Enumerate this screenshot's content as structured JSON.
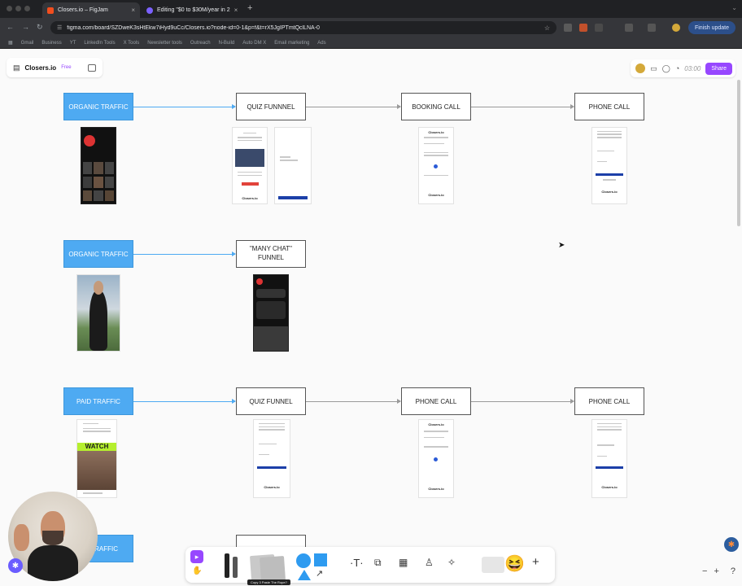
{
  "browser": {
    "tabs": [
      {
        "title": "Closers.io – FigJam",
        "active": true
      },
      {
        "title": "Editing \"$0 to $30M/year in 2",
        "active": false
      }
    ],
    "url": "figma.com/board/SZDweK3sHtEkw7iHyd9uCc/Closers.io?node-id=0-1&p=f&t=rX5JgIPTmtQclLNA-0",
    "finish_update": "Finish update",
    "bookmarks": [
      "Gmail",
      "Business",
      "YT",
      "LinkedIn Tools",
      "X Tools",
      "Newsletter tools",
      "Outreach",
      "N-Build",
      "Auto DM X",
      "Email marketing",
      "Ads"
    ]
  },
  "figjam": {
    "file_name": "Closers.io",
    "plan_badge": "Free",
    "timer": "03:00",
    "share_label": "Share"
  },
  "flows": [
    {
      "source": "ORGANIC TRAFFIC",
      "steps": [
        "QUIZ FUNNNEL",
        "BOOKING CALL",
        "PHONE CALL"
      ]
    },
    {
      "source": "ORGANIC TRAFFIC",
      "steps": [
        "\"MANY CHAT\" FUNNEL"
      ]
    },
    {
      "source": "PAID TRAFFIC",
      "steps": [
        "QUIZ FUNNEL",
        "PHONE CALL",
        "PHONE CALL"
      ]
    },
    {
      "source": "TRAFFIC",
      "steps": [
        ""
      ]
    }
  ],
  "thumbnail_text": {
    "brand": "Closers.io",
    "watch": "WATCH THIS"
  },
  "bottom_caption": "Copy 3 Paste The Rope?",
  "colors": {
    "traffic_blue": "#4eaaf2",
    "share_purple": "#9747ff",
    "shape_blue": "#2e9bf0",
    "cta_navy": "#1c3fa8"
  },
  "icons": [
    "menu-icon",
    "pages-icon",
    "chat-icon",
    "timer-icon",
    "cursor-icon",
    "hand-icon",
    "pen-icon",
    "text-icon",
    "section-icon",
    "table-icon",
    "stamp-icon",
    "widget-icon",
    "plus-icon",
    "zoom-out-icon",
    "zoom-in-icon",
    "help-icon"
  ]
}
